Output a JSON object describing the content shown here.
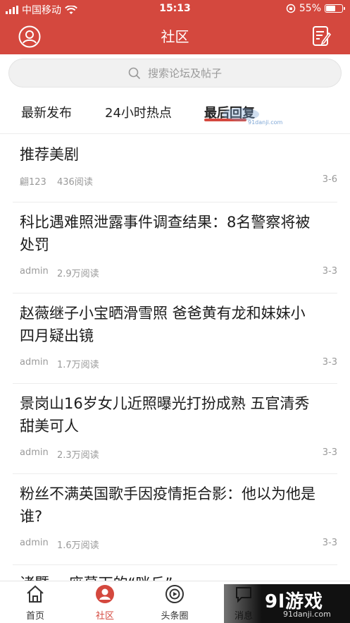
{
  "status": {
    "carrier": "中国移动",
    "time": "15:13",
    "battery": "55%"
  },
  "header": {
    "title": "社区"
  },
  "search": {
    "placeholder": "搜索论坛及帖子"
  },
  "tabs": [
    {
      "label": "最新发布"
    },
    {
      "label": "24小时热点"
    },
    {
      "label": "最后回复"
    }
  ],
  "watermark": {
    "tag": "91danji.com",
    "logo": "9l游戏",
    "logo_url": "91danji.com"
  },
  "posts": [
    {
      "title": "推荐美剧",
      "author": "翩123",
      "reads": "436阅读",
      "date": "3-6"
    },
    {
      "title": "科比遇难照泄露事件调查结果：8名警察将被处罚",
      "author": "admin",
      "reads": "2.9万阅读",
      "date": "3-3"
    },
    {
      "title": "赵薇继子小宝晒滑雪照 爸爸黄有龙和妹妹小四月疑出镜",
      "author": "admin",
      "reads": "1.7万阅读",
      "date": "3-3"
    },
    {
      "title": "景岗山16岁女儿近照曝光打扮成熟 五官清秀甜美可人",
      "author": "admin",
      "reads": "2.3万阅读",
      "date": "3-3"
    },
    {
      "title": "粉丝不满英国歌手因疫情拒合影：他以为他是谁?",
      "author": "admin",
      "reads": "1.6万阅读",
      "date": "3-3"
    },
    {
      "title": "诸暨 一座墓下的“咪丘”",
      "author": "",
      "reads": "",
      "date": ""
    }
  ],
  "tabbar": [
    {
      "label": "首页",
      "icon": "home-icon"
    },
    {
      "label": "社区",
      "icon": "community-icon"
    },
    {
      "label": "头条圈",
      "icon": "headline-icon"
    },
    {
      "label": "消息",
      "icon": "message-icon"
    }
  ],
  "colors": {
    "primary": "#d4483e",
    "text": "#1c1c1c",
    "muted": "#9a9a9a"
  }
}
